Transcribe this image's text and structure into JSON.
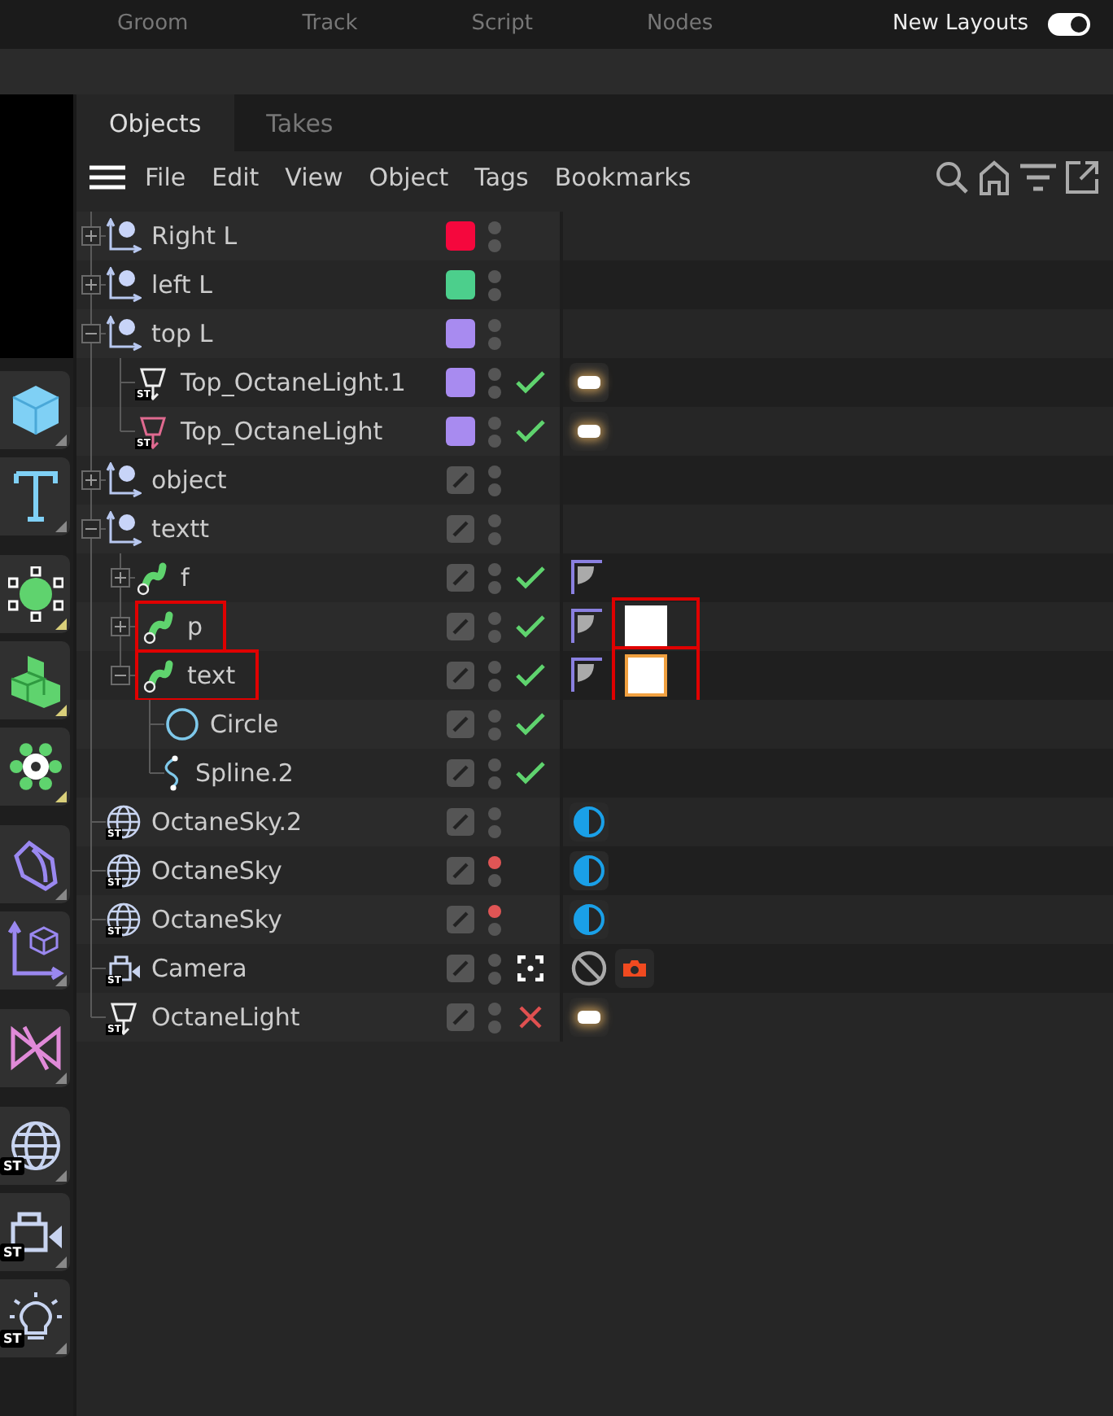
{
  "top_bar": {
    "items": [
      "Groom",
      "Track",
      "Script",
      "Nodes"
    ],
    "layout_label": "New Layouts",
    "layout_toggle_on": true
  },
  "toolbar": {
    "groups": [
      [
        {
          "kind": "cube"
        },
        {
          "kind": "text"
        }
      ],
      [
        {
          "kind": "points"
        },
        {
          "kind": "cubes"
        },
        {
          "kind": "gear"
        }
      ],
      [
        {
          "kind": "sweep"
        },
        {
          "kind": "axis"
        }
      ],
      [
        {
          "kind": "bow"
        }
      ],
      [
        {
          "kind": "globe",
          "badge": "ST"
        },
        {
          "kind": "camera",
          "badge": "ST"
        },
        {
          "kind": "bulb",
          "badge": "ST"
        }
      ]
    ]
  },
  "tabs": [
    {
      "label": "Objects",
      "selected": true
    },
    {
      "label": "Takes",
      "selected": false
    }
  ],
  "menu": [
    "File",
    "Edit",
    "View",
    "Object",
    "Tags",
    "Bookmarks"
  ],
  "objects": [
    {
      "name": "Right L",
      "kind": "null",
      "expanded": false,
      "color": "#f5073d",
      "editor_hidden": false
    },
    {
      "name": "left L",
      "kind": "null",
      "expanded": false,
      "color": "#4ccf8c",
      "editor_hidden": false
    },
    {
      "name": "top L",
      "kind": "null",
      "expanded": true,
      "color": "#a88bf0",
      "editor_hidden": false,
      "children": [
        {
          "name": "Top_OctaneLight.1",
          "kind": "light",
          "badge": "ST",
          "color": "#a88bf0",
          "editor_hidden": false,
          "enabled": true,
          "tags": [
            {
              "kind": "glow"
            }
          ]
        },
        {
          "name": "Top_OctaneLight",
          "kind": "light_pink",
          "badge": "ST",
          "color": "#a88bf0",
          "editor_hidden": false,
          "enabled": true,
          "tags": [
            {
              "kind": "glow"
            }
          ]
        }
      ]
    },
    {
      "name": "object",
      "kind": "null",
      "expanded": false,
      "editor_hidden": false
    },
    {
      "name": "textt",
      "kind": "null",
      "expanded": true,
      "editor_hidden": false,
      "children": [
        {
          "name": "f",
          "kind": "sweep",
          "expanded": false,
          "editor_hidden": false,
          "enabled": true,
          "tags": [
            {
              "kind": "phong"
            }
          ]
        },
        {
          "name": "p",
          "kind": "sweep",
          "expanded": false,
          "highlighted": true,
          "editor_hidden": false,
          "enabled": true,
          "tags": [
            {
              "kind": "phong"
            },
            {
              "kind": "material",
              "selected": false,
              "highlighted": true
            }
          ]
        },
        {
          "name": "text",
          "kind": "sweep",
          "expanded": true,
          "highlighted": true,
          "editor_hidden": false,
          "enabled": true,
          "tags": [
            {
              "kind": "phong"
            },
            {
              "kind": "material",
              "selected": true,
              "highlighted": true
            }
          ],
          "children": [
            {
              "name": "Circle",
              "kind": "circle",
              "editor_hidden": false,
              "enabled": true
            },
            {
              "name": "Spline.2",
              "kind": "spline",
              "editor_hidden": false,
              "enabled": true
            }
          ]
        }
      ]
    },
    {
      "name": "OctaneSky.2",
      "kind": "globe",
      "badge": "ST",
      "editor_hidden": false,
      "tags": [
        {
          "kind": "sky"
        }
      ]
    },
    {
      "name": "OctaneSky",
      "kind": "globe",
      "badge": "ST",
      "editor_hidden": true,
      "tags": [
        {
          "kind": "sky"
        }
      ]
    },
    {
      "name": "OctaneSky",
      "kind": "globe",
      "badge": "ST",
      "editor_hidden": true,
      "tags": [
        {
          "kind": "sky"
        }
      ]
    },
    {
      "name": "Camera",
      "kind": "camera",
      "badge": "ST",
      "editor_hidden": false,
      "focus_target": true,
      "tags": [
        {
          "kind": "ban"
        },
        {
          "kind": "photo"
        }
      ]
    },
    {
      "name": "OctaneLight",
      "kind": "light",
      "badge": "ST",
      "editor_hidden": false,
      "enabled": false,
      "tags": [
        {
          "kind": "glow"
        }
      ]
    }
  ]
}
